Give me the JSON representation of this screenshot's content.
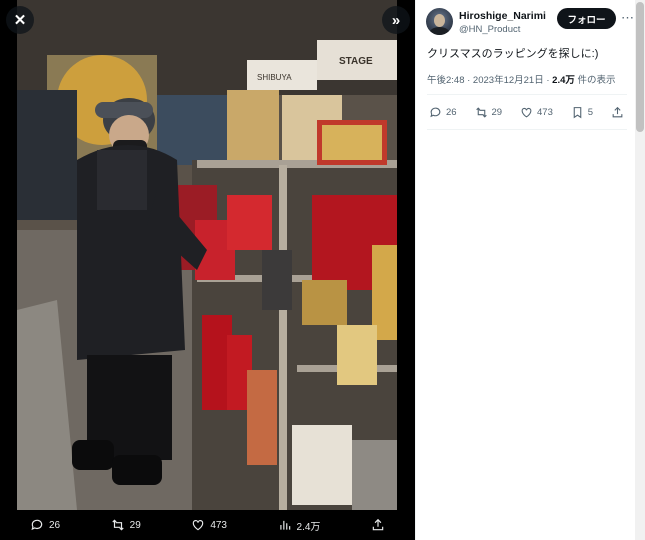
{
  "viewer": {
    "close_icon": "close-icon",
    "expand_icon": "chevrons-right-icon",
    "actions": {
      "replies": "26",
      "reposts": "29",
      "likes": "473",
      "views": "2.4万"
    }
  },
  "post": {
    "display_name": "Hiroshige_Narimi",
    "handle": "@HN_Product",
    "follow_label": "フォロー",
    "more_icon": "more-icon",
    "text": "クリスマスのラッピングを探しに:)",
    "time": "午後2:48 · 2023年12月21日 · ",
    "views_count": "2.4万",
    "views_suffix": " 件の表示",
    "stats": {
      "replies": "26",
      "reposts": "29",
      "likes": "473",
      "bookmarks": "5"
    }
  },
  "photo_signs": {
    "sign1": "STAGE",
    "sign2": "SHIBUYA"
  },
  "colors": {
    "viewer_bg": "#000000",
    "follow_bg": "#0f1419",
    "meta_text": "#536471"
  }
}
